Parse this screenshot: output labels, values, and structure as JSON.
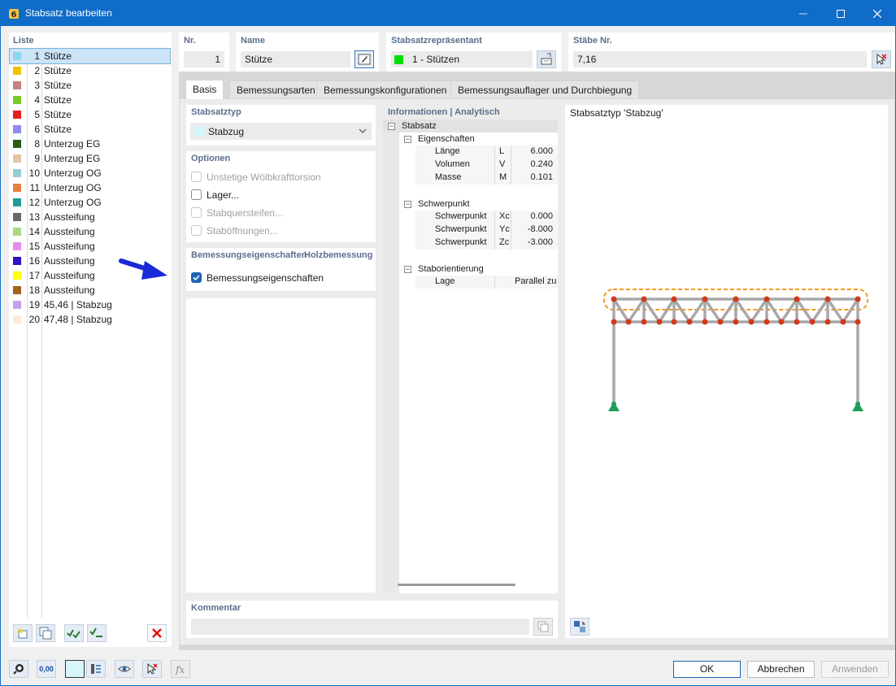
{
  "window": {
    "title": "Stabsatz bearbeiten"
  },
  "list": {
    "header": "Liste",
    "items": [
      {
        "num": "1",
        "name": "Stütze",
        "color": "#8dd6ef"
      },
      {
        "num": "2",
        "name": "Stütze",
        "color": "#f2c200"
      },
      {
        "num": "3",
        "name": "Stütze",
        "color": "#c88080"
      },
      {
        "num": "4",
        "name": "Stütze",
        "color": "#78c828"
      },
      {
        "num": "5",
        "name": "Stütze",
        "color": "#e81c1c"
      },
      {
        "num": "6",
        "name": "Stütze",
        "color": "#8c8cf0"
      },
      {
        "num": "8",
        "name": "Unterzug EG",
        "color": "#2a5c18"
      },
      {
        "num": "9",
        "name": "Unterzug EG",
        "color": "#e8c4a4"
      },
      {
        "num": "10",
        "name": "Unterzug OG",
        "color": "#98ccd0"
      },
      {
        "num": "11",
        "name": "Unterzug OG",
        "color": "#e88040"
      },
      {
        "num": "12",
        "name": "Unterzug OG",
        "color": "#209c98"
      },
      {
        "num": "13",
        "name": "Aussteifung",
        "color": "#686868"
      },
      {
        "num": "14",
        "name": "Aussteifung",
        "color": "#a8d884"
      },
      {
        "num": "15",
        "name": "Aussteifung",
        "color": "#e090e8"
      },
      {
        "num": "16",
        "name": "Aussteifung",
        "color": "#2c14c0"
      },
      {
        "num": "17",
        "name": "Aussteifung",
        "color": "#ffff10"
      },
      {
        "num": "18",
        "name": "Aussteifung",
        "color": "#a0641c"
      },
      {
        "num": "19",
        "name": "45,46 | Stabzug",
        "color": "#c8a0e8"
      },
      {
        "num": "20",
        "name": "47,48 | Stabzug",
        "color": "#fcecd4"
      }
    ]
  },
  "header": {
    "nr_label": "Nr.",
    "nr_value": "1",
    "name_label": "Name",
    "name_value": "Stütze",
    "rep_label": "Stabsatzrepräsentant",
    "rep_value": "1 - Stützen",
    "rep_color": "#00dd00",
    "staebe_label": "Stäbe Nr.",
    "staebe_value": "7,16"
  },
  "tabs": [
    "Basis",
    "Bemessungsarten",
    "Bemessungskonfigurationen",
    "Bemessungsauflager und Durchbiegung"
  ],
  "basis": {
    "typ_label": "Stabsatztyp",
    "typ_value": "Stabzug",
    "optionen_label": "Optionen",
    "opt_woelb": "Unstetige Wölbkrafttorsion",
    "opt_lager": "Lager...",
    "opt_steifen": "Stabquersteifen...",
    "opt_oeffnungen": "Staböffnungen...",
    "bem_header_a": "Bemessungseigenschaften",
    "bem_header_b": "Holzbemessung",
    "bem_check": "Bemessungseigenschaften"
  },
  "info": {
    "header": "Informationen | Analytisch",
    "root": "Stabsatz",
    "eig": "Eigenschaften",
    "laenge": {
      "label": "Länge",
      "sym": "L",
      "val": "6.000"
    },
    "volumen": {
      "label": "Volumen",
      "sym": "V",
      "val": "0.240"
    },
    "masse": {
      "label": "Masse",
      "sym": "M",
      "val": "0.101"
    },
    "schwer": "Schwerpunkt",
    "xc": {
      "label": "Schwerpunkt",
      "sym": "Xc",
      "val": "0.000"
    },
    "yc": {
      "label": "Schwerpunkt",
      "sym": "Yc",
      "val": "-8.000"
    },
    "zc": {
      "label": "Schwerpunkt",
      "sym": "Zc",
      "val": "-3.000"
    },
    "orient": "Staborientierung",
    "lage": {
      "label": "Lage",
      "val": "Parallel zu"
    }
  },
  "preview": {
    "caption": "Stabsatztyp 'Stabzug'"
  },
  "kommentar": {
    "label": "Kommentar"
  },
  "buttons": {
    "ok": "OK",
    "abbrechen": "Abbrechen",
    "anwenden": "Anwenden"
  },
  "toolbar": {
    "units_text": "0,00"
  }
}
